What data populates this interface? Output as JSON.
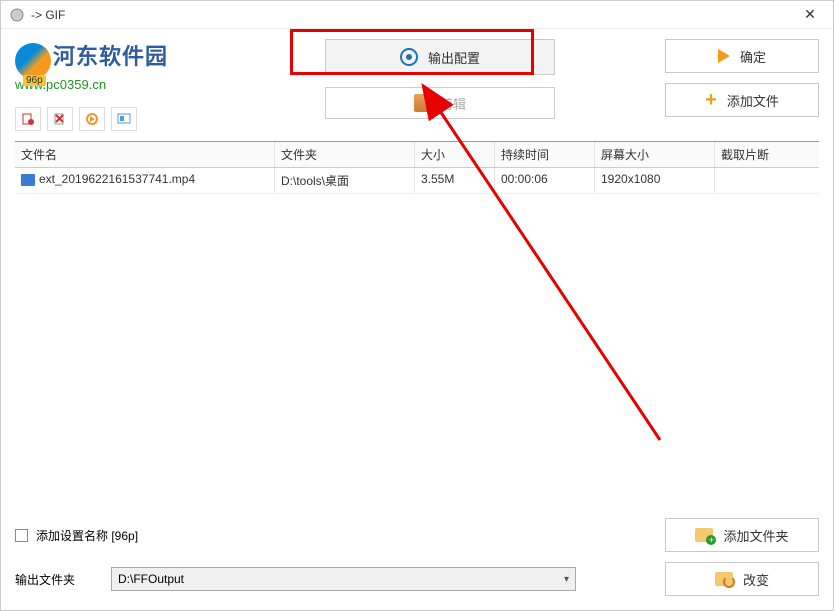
{
  "window": {
    "title": "-> GIF"
  },
  "watermark": {
    "title": "河东软件园",
    "url": "www.pc0359.cn",
    "badge": "96p"
  },
  "top_buttons": {
    "output_config": "输出配置",
    "edit": "剪辑",
    "confirm": "确定",
    "add_file": "添加文件"
  },
  "toolbar": {
    "icon1": "remove",
    "icon2": "clear",
    "icon3": "play",
    "icon4": "view"
  },
  "table": {
    "headers": {
      "name": "文件名",
      "folder": "文件夹",
      "size": "大小",
      "duration": "持续时间",
      "screen": "屏幕大小",
      "clip": "截取片断"
    },
    "rows": [
      {
        "name": "ext_2019622161537741.mp4",
        "folder": "D:\\tools\\桌面",
        "size": "3.55M",
        "duration": "00:00:06",
        "screen": "1920x1080",
        "clip": ""
      }
    ]
  },
  "bottom": {
    "add_setting_name_label": "添加设置名称 [96p]",
    "output_folder_label": "输出文件夹",
    "output_folder_value": "D:\\FFOutput",
    "add_folder_btn": "添加文件夹",
    "change_btn": "改变"
  }
}
